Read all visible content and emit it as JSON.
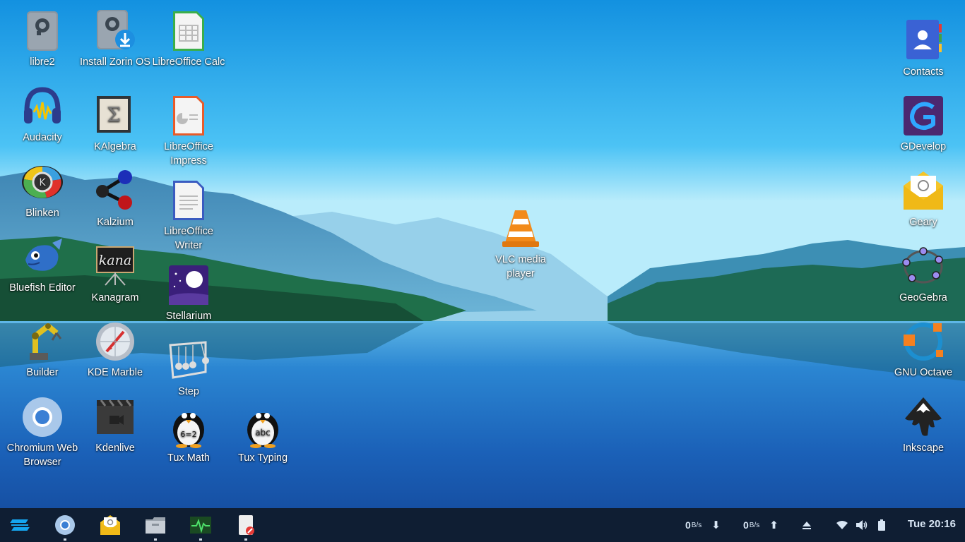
{
  "desktop": {
    "left_icons": [
      {
        "label": "libre2",
        "icon": "drive-icon"
      },
      {
        "label": "Install Zorin OS",
        "icon": "install-zorin-icon"
      },
      {
        "label": "LibreOffice Calc",
        "icon": "calc-icon"
      },
      {
        "label": "Audacity",
        "icon": "audacity-icon"
      },
      {
        "label": "KAlgebra",
        "icon": "kalgebra-icon"
      },
      {
        "label": "LibreOffice Impress",
        "icon": "impress-icon"
      },
      {
        "label": "Blinken",
        "icon": "blinken-icon"
      },
      {
        "label": "Kalzium",
        "icon": "kalzium-icon"
      },
      {
        "label": "LibreOffice Writer",
        "icon": "writer-icon"
      },
      {
        "label": "Bluefish Editor",
        "icon": "bluefish-icon"
      },
      {
        "label": "Kanagram",
        "icon": "kanagram-icon"
      },
      {
        "label": "Stellarium",
        "icon": "stellarium-icon"
      },
      {
        "label": "Builder",
        "icon": "builder-icon"
      },
      {
        "label": "KDE Marble",
        "icon": "marble-icon"
      },
      {
        "label": "Step",
        "icon": "step-icon"
      },
      {
        "label": "Chromium Web Browser",
        "icon": "chromium-icon"
      },
      {
        "label": "Kdenlive",
        "icon": "kdenlive-icon"
      },
      {
        "label": "Tux Math",
        "icon": "tuxmath-icon"
      },
      {
        "label": "Tux Typing",
        "icon": "tuxtyping-icon"
      }
    ],
    "center_icons": [
      {
        "label": "VLC media player",
        "icon": "vlc-icon"
      }
    ],
    "right_icons": [
      {
        "label": "Contacts",
        "icon": "contacts-icon"
      },
      {
        "label": "GDevelop",
        "icon": "gdevelop-icon"
      },
      {
        "label": "Geary",
        "icon": "geary-icon"
      },
      {
        "label": "GeoGebra",
        "icon": "geogebra-icon"
      },
      {
        "label": "GNU Octave",
        "icon": "octave-icon"
      },
      {
        "label": "Inkscape",
        "icon": "inkscape-icon"
      }
    ]
  },
  "taskbar": {
    "launchers": [
      "zorin-menu-icon",
      "chromium-icon",
      "geary-icon",
      "files-icon",
      "system-monitor-icon",
      "text-editor-icon"
    ],
    "net_down": {
      "value": "0",
      "unit": "B/s"
    },
    "net_up": {
      "value": "0",
      "unit": "B/s"
    },
    "clock": "Tue 20:16"
  },
  "colors": {
    "taskbar_bg": "#0f1e33",
    "accent": "#15a6f0"
  }
}
